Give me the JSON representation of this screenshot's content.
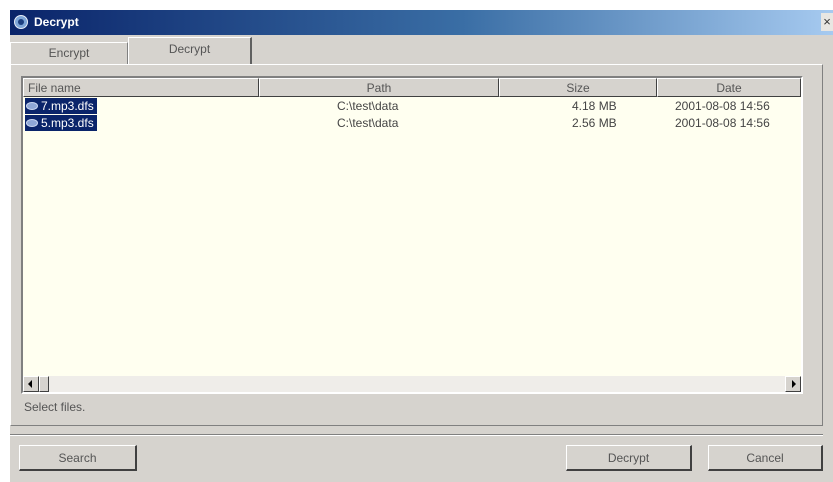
{
  "window": {
    "title": "Decrypt",
    "close_label": "×"
  },
  "tabs": [
    {
      "label": "Encrypt",
      "active": false
    },
    {
      "label": "Decrypt",
      "active": true
    }
  ],
  "list": {
    "columns": [
      "File name",
      "Path",
      "Size",
      "Date"
    ],
    "rows": [
      {
        "name": "7.mp3.dfs",
        "path": "C:\\test\\data",
        "size": "4.18 MB",
        "date": "2001-08-08 14:56",
        "selected": true
      },
      {
        "name": "5.mp3.dfs",
        "path": "C:\\test\\data",
        "size": "2.56 MB",
        "date": "2001-08-08 14:56",
        "selected": true
      }
    ]
  },
  "status": {
    "text": "Select files."
  },
  "buttons": {
    "search": "Search",
    "decrypt": "Decrypt",
    "cancel": "Cancel"
  },
  "colors": {
    "title_bar": "#0a246a",
    "list_background": "#fffff0",
    "selection": "#0a246a",
    "face": "#d6d3ce"
  },
  "icons": {
    "title": "app-icon",
    "file": "encrypted-file-icon"
  }
}
